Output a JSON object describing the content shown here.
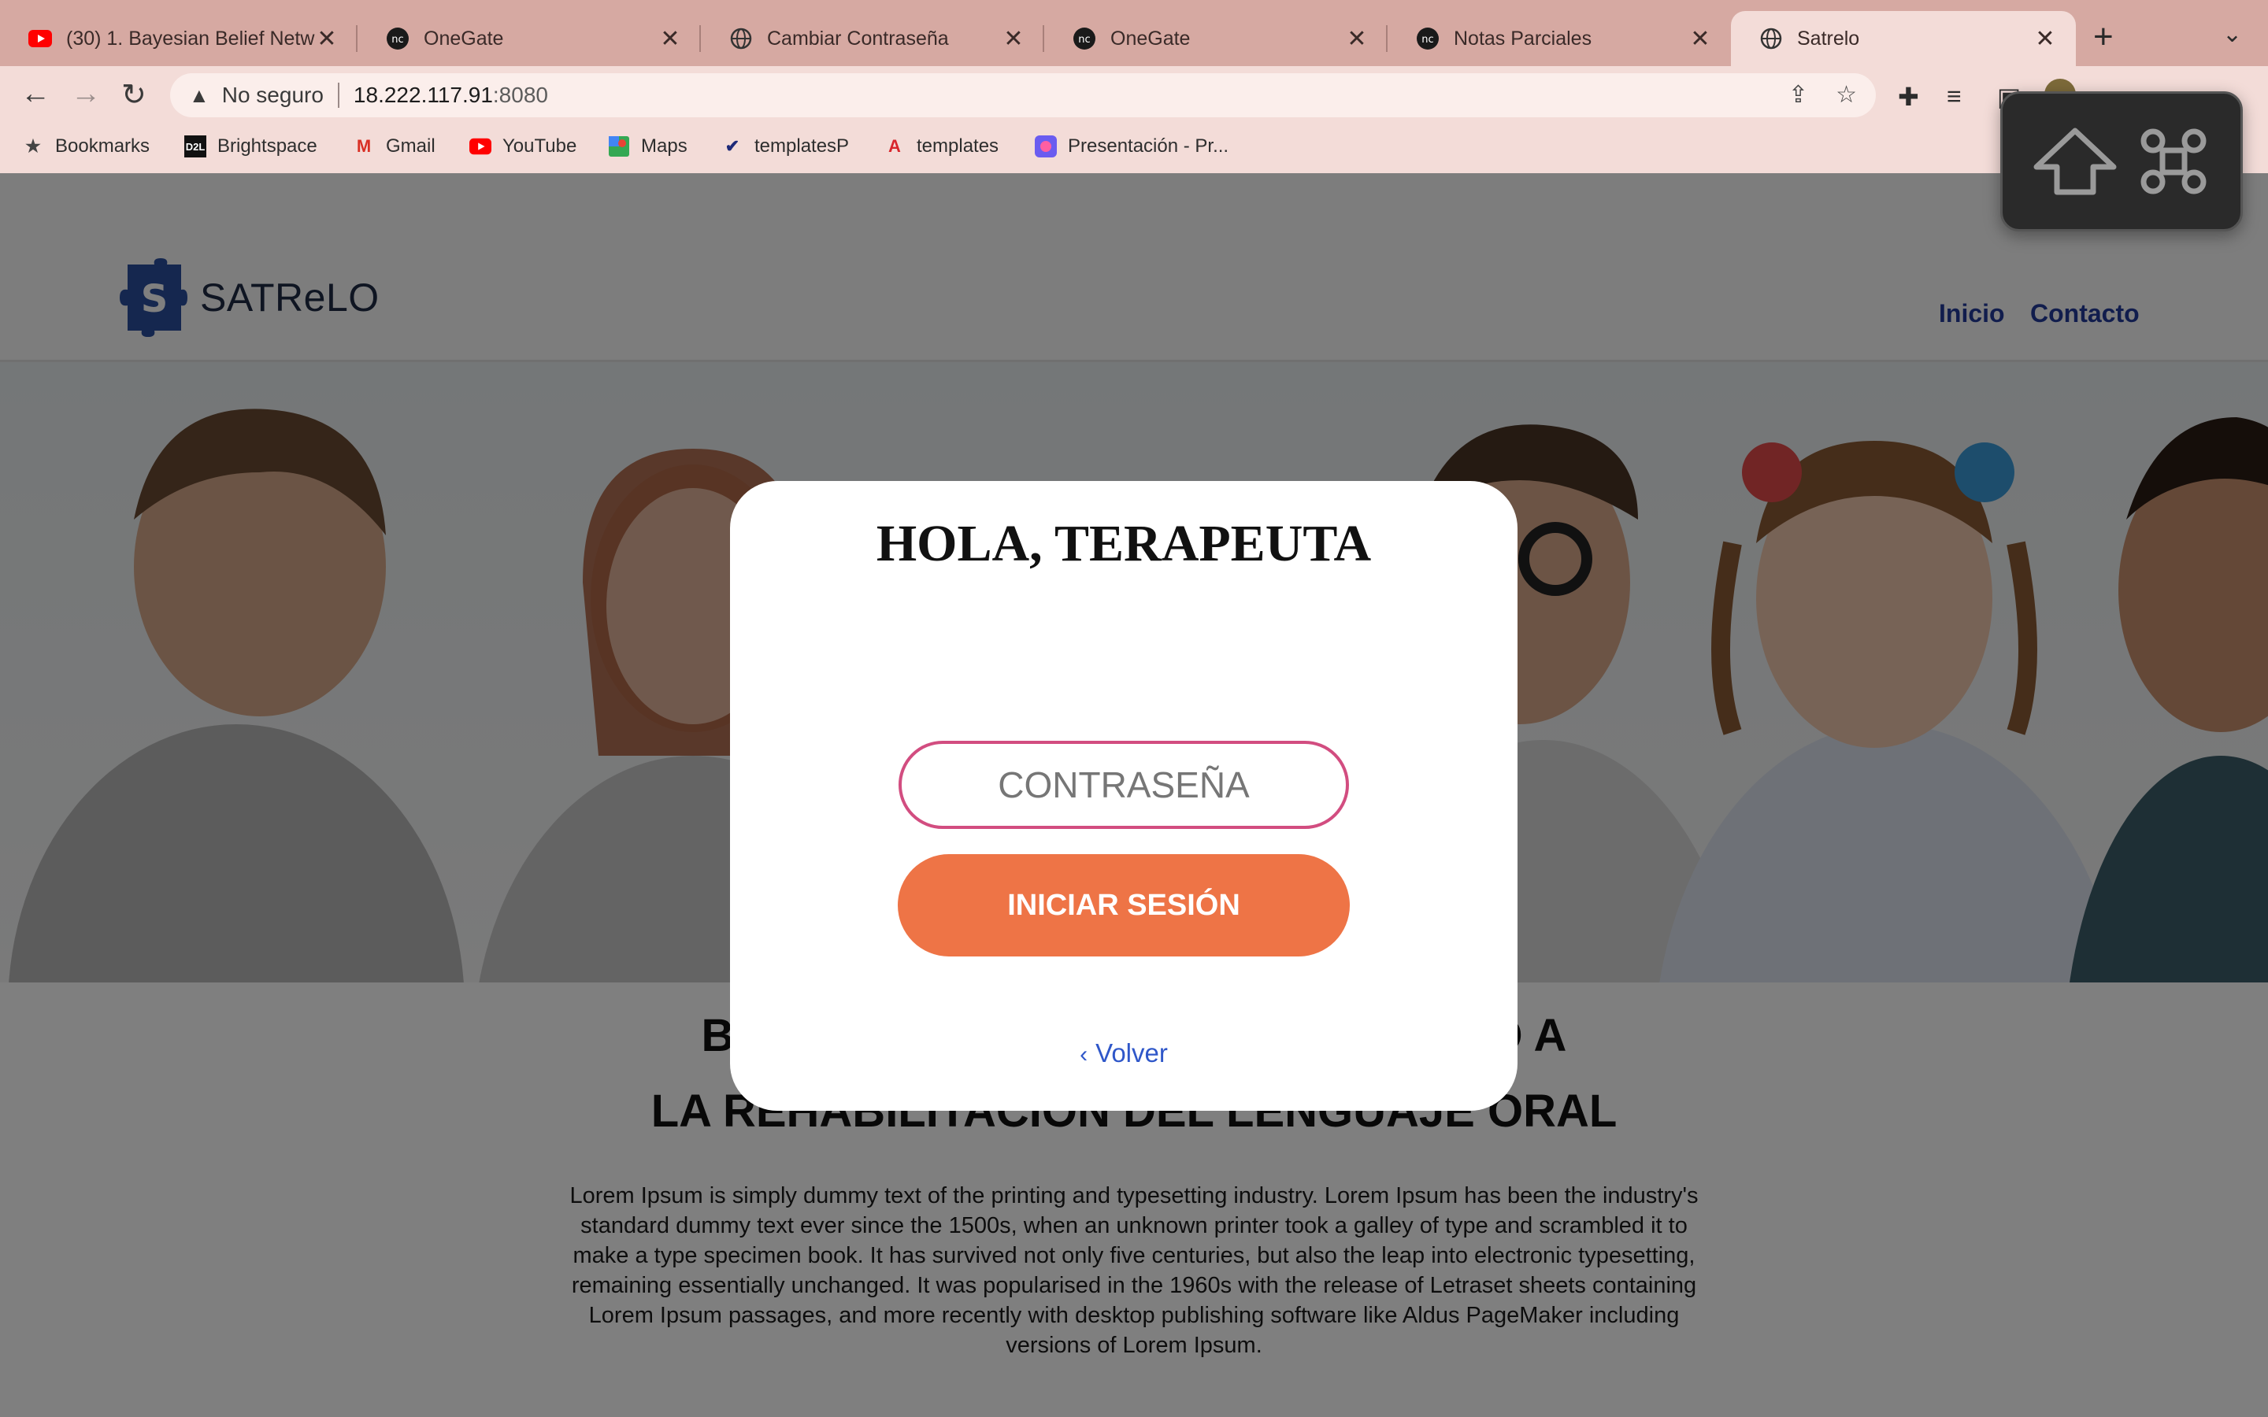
{
  "browser": {
    "tabs": [
      {
        "title": "(30) 1. Bayesian Belief Netw",
        "icon": "youtube-icon"
      },
      {
        "title": "OneGate",
        "icon": "onegate-icon"
      },
      {
        "title": "Cambiar Contraseña",
        "icon": "globe-icon"
      },
      {
        "title": "OneGate",
        "icon": "onegate-icon"
      },
      {
        "title": "Notas Parciales",
        "icon": "onegate-icon"
      },
      {
        "title": "Satrelo",
        "icon": "globe-icon",
        "active": true
      }
    ],
    "address": {
      "security_label": "No seguro",
      "host": "18.222.117.91",
      "port": ":8080"
    },
    "bookmarks": [
      {
        "label": "Bookmarks",
        "icon": "star-icon"
      },
      {
        "label": "Brightspace",
        "icon": "d2l-icon"
      },
      {
        "label": "Gmail",
        "icon": "gmail-icon"
      },
      {
        "label": "YouTube",
        "icon": "youtube-icon"
      },
      {
        "label": "Maps",
        "icon": "maps-icon"
      },
      {
        "label": "templatesP",
        "icon": "templatesp-icon"
      },
      {
        "label": "templates",
        "icon": "templates-icon"
      },
      {
        "label": "Presentación - Pr...",
        "icon": "presentation-icon"
      }
    ],
    "shortcut_overlay": [
      "shift-icon",
      "command-icon"
    ]
  },
  "site": {
    "logo_text": "SATReLO",
    "nav": {
      "inicio": "Inicio",
      "contacto": "Contacto"
    },
    "accent_color": "#233a9a"
  },
  "main": {
    "welcome_line1": "BIENVENIDO AL SISTEMA DE APOYO A",
    "welcome_line2": "LA REHABILITACIÓN DEL LENGUAJE ORAL",
    "body_text": "Lorem Ipsum is simply dummy text of the printing and typesetting industry. Lorem Ipsum has been the industry's standard dummy text ever since the 1500s, when an unknown printer took a galley of type and scrambled it to make a type specimen book. It has survived not only five centuries, but also the leap into electronic typesetting, remaining essentially unchanged. It was popularised in the 1960s with the release of Letraset sheets containing Lorem Ipsum passages, and more recently with desktop publishing software like Aldus PageMaker including versions of Lorem Ipsum."
  },
  "modal": {
    "title": "HOLA, TERAPEUTA",
    "password_placeholder": "CONTRASEÑA",
    "login_label": "INICIAR SESIÓN",
    "back_label": "Volver",
    "input_border_color": "#d24d80",
    "button_color": "#ee7446",
    "link_color": "#2f57c9"
  }
}
